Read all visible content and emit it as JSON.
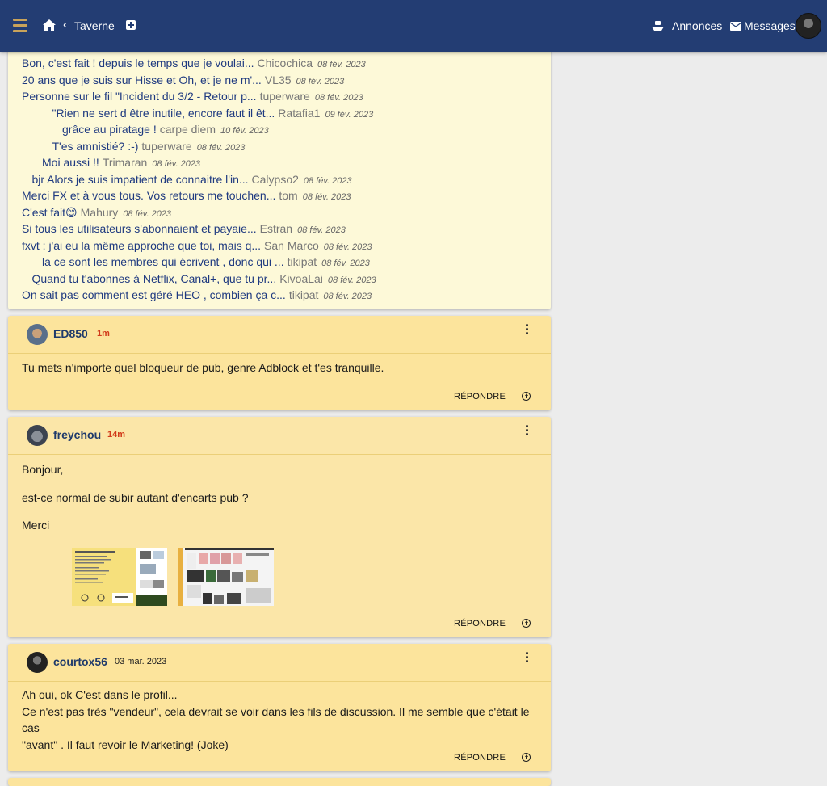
{
  "header": {
    "breadcrumb": "Taverne",
    "ads_label": "Annonces",
    "messages_label": "Messages"
  },
  "thread_replies": [
    {
      "title": "Bon, c'est fait ! depuis le temps que je voulai...",
      "author": "Chicochica",
      "date": "08 fév. 2023",
      "indent": 0
    },
    {
      "title": "20 ans que je suis sur Hisse et Oh, et je ne m'...",
      "author": "VL35",
      "date": "08 fév. 2023",
      "indent": 0
    },
    {
      "title": "Personne sur le fil \"Incident du 3/2 - Retour p...",
      "author": "tuperware",
      "date": "08 fév. 2023",
      "indent": 0
    },
    {
      "title": "\"Rien ne sert d être inutile, encore faut il êt...",
      "author": "Ratafia1",
      "date": "09 fév. 2023",
      "indent": 3
    },
    {
      "title": "grâce au piratage !",
      "author": "carpe diem",
      "date": "10 fév. 2023",
      "indent": 4
    },
    {
      "title": "T'es amnistié? :-)",
      "author": "tuperware",
      "date": "08 fév. 2023",
      "indent": 3
    },
    {
      "title": "Moi aussi !!",
      "author": "Trimaran",
      "date": "08 fév. 2023",
      "indent": 2
    },
    {
      "title": "bjr Alors je suis impatient de connaitre l'in...",
      "author": "Calypso2",
      "date": "08 fév. 2023",
      "indent": 1
    },
    {
      "title": "Merci FX et à vous tous. Vos retours me touchen...",
      "author": "tom",
      "date": "08 fév. 2023",
      "indent": 0
    },
    {
      "title": "C'est fait😊",
      "author": "Mahury",
      "date": "08 fév. 2023",
      "indent": 0
    },
    {
      "title": "Si tous les utilisateurs s'abonnaient et payaie...",
      "author": "Estran",
      "date": "08 fév. 2023",
      "indent": 0
    },
    {
      "title": "fxvt : j'ai eu la même approche que toi, mais q...",
      "author": "San Marco",
      "date": "08 fév. 2023",
      "indent": 0
    },
    {
      "title": "la ce sont les membres qui écrivent , donc qui ...",
      "author": "tikipat",
      "date": "08 fév. 2023",
      "indent": 2
    },
    {
      "title": "Quand tu t'abonnes à Netflix, Canal+, que tu pr...",
      "author": "KivoaLai",
      "date": "08 fév. 2023",
      "indent": 1
    },
    {
      "title": "On sait pas comment est géré HEO , combien ça c...",
      "author": "tikipat",
      "date": "08 fév. 2023",
      "indent": 0
    }
  ],
  "posts": [
    {
      "author": "ED850",
      "time": "1m",
      "body": "Tu mets n'importe quel bloqueur de pub, genre Adblock et t'es tranquille.",
      "reply_label": "RÉPONDRE"
    },
    {
      "author": "freychou",
      "time": "14m",
      "body_lines": [
        "Bonjour,",
        "est-ce normal de subir autant d'encarts pub ?",
        "Merci"
      ],
      "reply_label": "RÉPONDRE"
    },
    {
      "author": "courtox56",
      "date": "03 mar. 2023",
      "body_lines": [
        "Ah oui, ok C'est dans le profil...",
        "Ce n'est pas très \"vendeur\", cela devrait se voir dans les fils de discussion. Il me semble que c'était le cas",
        "\"avant\" . Il faut revoir le Marketing! (Joke)"
      ],
      "reply_label": "RÉPONDRE"
    }
  ],
  "icons": {
    "menu": "hamburger-icon",
    "home": "home-icon",
    "back": "chevron-left-icon",
    "new": "plus-square-icon",
    "ads": "boat-icon",
    "messages": "envelope-icon",
    "more": "kebab-icon",
    "scroll_up": "arrow-up-circle-icon"
  },
  "colors": {
    "topbar": "#233d73",
    "accent_menu": "#c9a35a",
    "link": "#1f3a80",
    "post_bg": "#fce49c",
    "thread_bg": "#fdf9d8",
    "time_red": "#d13a1a"
  }
}
